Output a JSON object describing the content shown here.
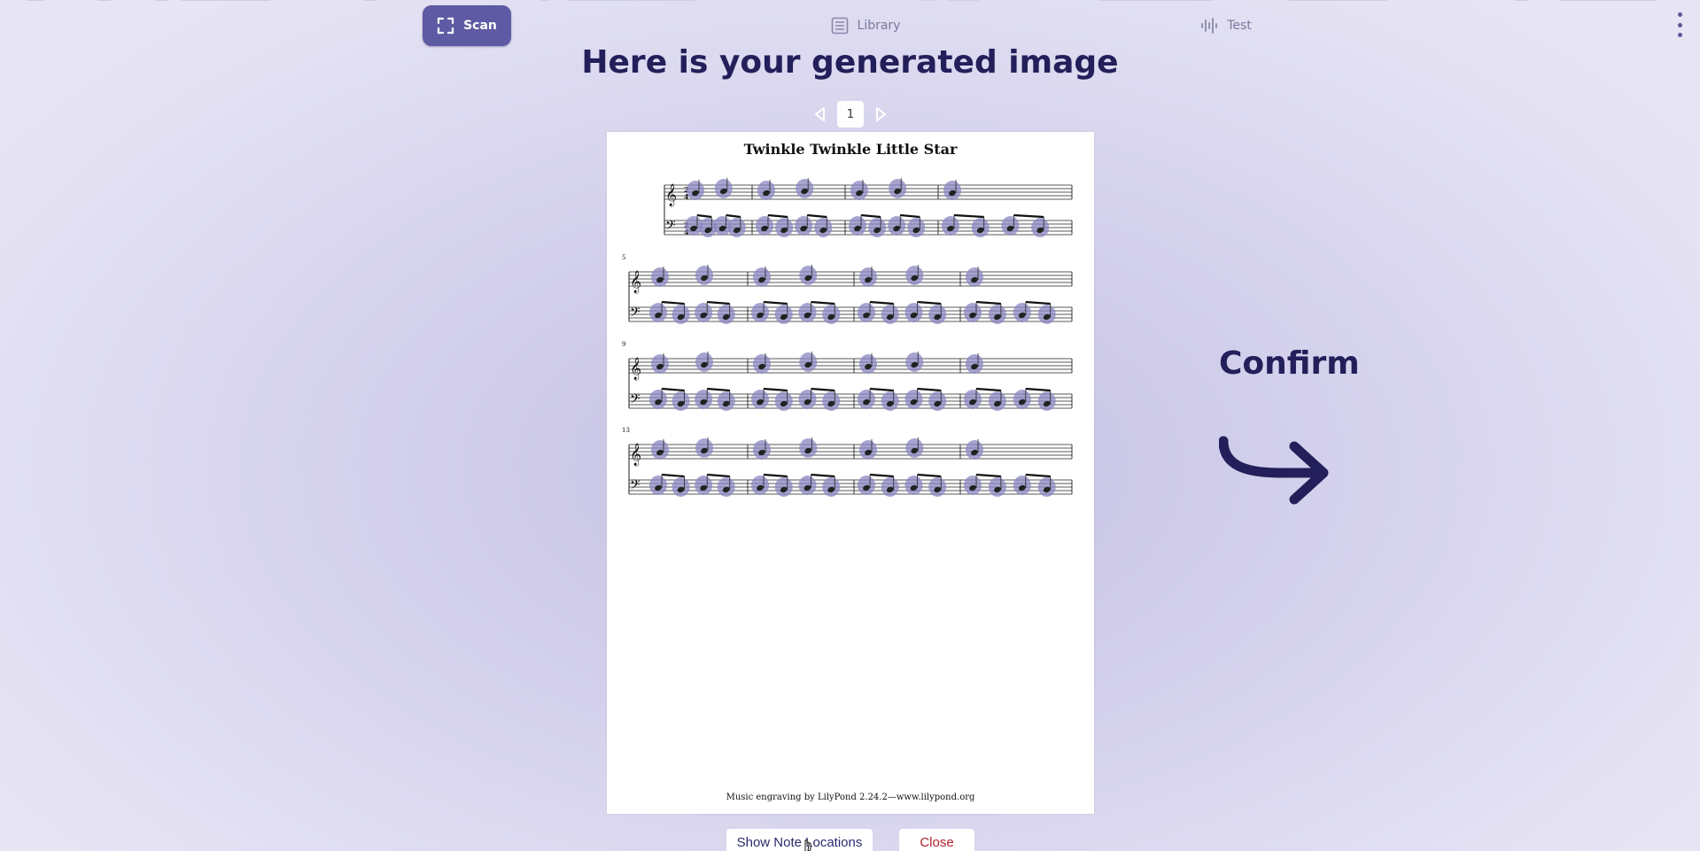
{
  "nav": {
    "scan_label": "Scan",
    "library_label": "Library",
    "test_label": "Test"
  },
  "main": {
    "headline": "Here is your generated image",
    "pager": {
      "current_page": "1"
    },
    "score": {
      "title": "Twinkle Twinkle Little Star",
      "engraving_credit": "Music engraving by LilyPond 2.24.2—www.lilypond.org",
      "system_numbers": [
        "5",
        "9",
        "13"
      ],
      "time_signature": [
        "2",
        "4"
      ]
    }
  },
  "confirm": {
    "label": "Confirm"
  },
  "actions": {
    "show_notes_label": "Show Note Locations",
    "close_label": "Close"
  },
  "colors": {
    "accent": "#5e5aa3",
    "headline": "#231f5a",
    "close": "#b0212b",
    "note_highlight": "#8a86c2"
  }
}
